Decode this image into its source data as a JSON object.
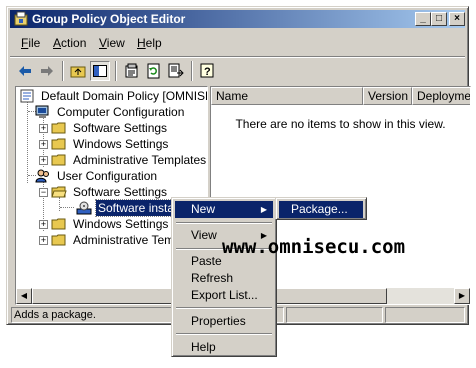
{
  "window": {
    "title": "Group Policy Object Editor",
    "controls": {
      "minimize": "_",
      "maximize": "□",
      "close": "×"
    }
  },
  "menubar": {
    "items": [
      {
        "label": "File",
        "accel": "F",
        "rest": "ile"
      },
      {
        "label": "Action",
        "accel": "A",
        "rest": "ction"
      },
      {
        "label": "View",
        "accel": "V",
        "rest": "iew"
      },
      {
        "label": "Help",
        "accel": "H",
        "rest": "elp"
      }
    ]
  },
  "toolbar": {
    "buttons": [
      "back-icon",
      "forward-icon",
      "up-folder-icon",
      "show-hide-tree-icon",
      "properties-icon",
      "refresh-icon",
      "export-list-icon",
      "help-icon"
    ]
  },
  "tree": {
    "root": "Default Domain Policy [OMNISERV-",
    "computer_config": "Computer Configuration",
    "cc_software": "Software Settings",
    "cc_windows": "Windows Settings",
    "cc_admin": "Administrative Templates",
    "user_config": "User Configuration",
    "uc_software": "Software Settings",
    "uc_software_install": "Software installa",
    "uc_windows": "Windows Settings",
    "uc_admin": "Administrative Templ"
  },
  "list": {
    "columns": [
      "Name",
      "Version",
      "Deploymen"
    ],
    "empty_message": "There are no items to show in this view."
  },
  "status": {
    "text": "Adds a package."
  },
  "context_menu": {
    "new": "New",
    "view": "View",
    "paste": "Paste",
    "refresh": "Refresh",
    "export_list": "Export List...",
    "properties": "Properties",
    "help": "Help"
  },
  "submenu": {
    "package": "Package..."
  },
  "watermark": "www.omnisecu.com",
  "colors": {
    "title_start": "#0a246a",
    "title_end": "#a6caf0",
    "selection": "#0a246a",
    "face": "#d4d0c8"
  }
}
